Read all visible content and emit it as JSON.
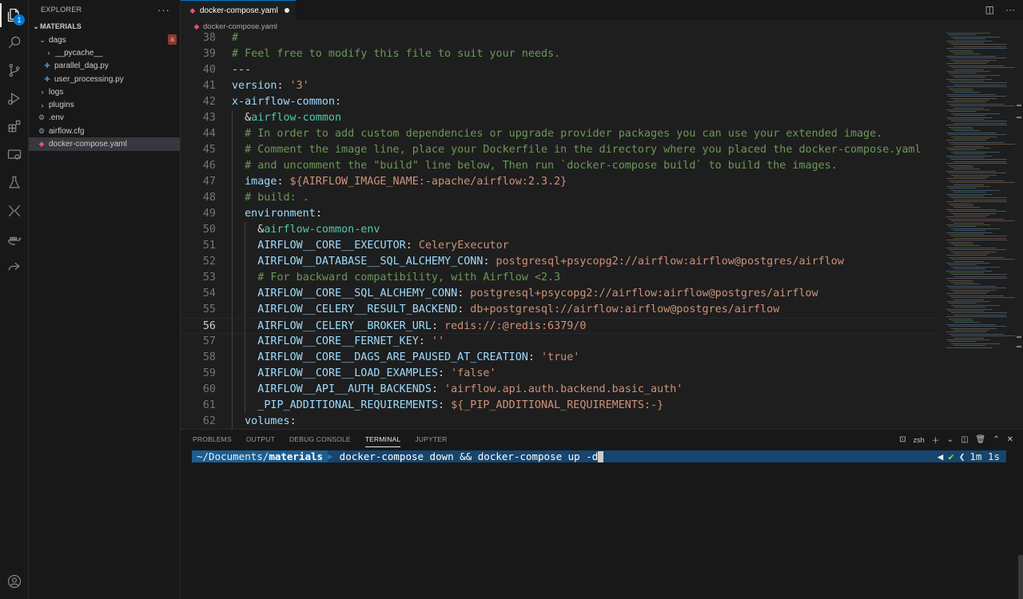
{
  "sidebar": {
    "title": "EXPLORER",
    "section": "MATERIALS",
    "items": [
      {
        "label": "dags",
        "git": "a"
      },
      {
        "label": "__pycache__"
      },
      {
        "label": "parallel_dag.py"
      },
      {
        "label": "user_processing.py"
      },
      {
        "label": "logs"
      },
      {
        "label": "plugins"
      },
      {
        "label": ".env"
      },
      {
        "label": "airflow.cfg"
      },
      {
        "label": "docker-compose.yaml"
      }
    ]
  },
  "activity": {
    "explorer_badge": "1"
  },
  "editor": {
    "tab_label": "docker-compose.yaml",
    "breadcrumb": "docker-compose.yaml",
    "lines": [
      {
        "n": "38",
        "t": "#"
      },
      {
        "n": "39",
        "t": "# Feel free to modify this file to suit your needs."
      },
      {
        "n": "40",
        "t": "---"
      },
      {
        "n": "41",
        "k": "version",
        "v": " '3'"
      },
      {
        "n": "42",
        "k": "x-airflow-common",
        "v": ""
      },
      {
        "n": "43",
        "a": "&airflow-common"
      },
      {
        "n": "44",
        "t": "# In order to add custom dependencies or upgrade provider packages you can use your extended image."
      },
      {
        "n": "45",
        "t": "# Comment the image line, place your Dockerfile in the directory where you placed the docker-compose.yaml"
      },
      {
        "n": "46",
        "t": "# and uncomment the \"build\" line below, Then run `docker-compose build` to build the images."
      },
      {
        "n": "47",
        "k": "image",
        "v": " ${AIRFLOW_IMAGE_NAME:-apache/airflow:2.3.2}"
      },
      {
        "n": "48",
        "t": "# build: ."
      },
      {
        "n": "49",
        "k": "environment",
        "v": ""
      },
      {
        "n": "50",
        "a": "&airflow-common-env"
      },
      {
        "n": "51",
        "k": "AIRFLOW__CORE__EXECUTOR",
        "v": " CeleryExecutor"
      },
      {
        "n": "52",
        "k": "AIRFLOW__DATABASE__SQL_ALCHEMY_CONN",
        "v": " postgresql+psycopg2://airflow:airflow@postgres/airflow"
      },
      {
        "n": "53",
        "t": "# For backward compatibility, with Airflow <2.3"
      },
      {
        "n": "54",
        "k": "AIRFLOW__CORE__SQL_ALCHEMY_CONN",
        "v": " postgresql+psycopg2://airflow:airflow@postgres/airflow"
      },
      {
        "n": "55",
        "k": "AIRFLOW__CELERY__RESULT_BACKEND",
        "v": " db+postgresql://airflow:airflow@postgres/airflow"
      },
      {
        "n": "56",
        "k": "AIRFLOW__CELERY__BROKER_URL",
        "v": " redis://:@redis:6379/0"
      },
      {
        "n": "57",
        "k": "AIRFLOW__CORE__FERNET_KEY",
        "v": " ''"
      },
      {
        "n": "58",
        "k": "AIRFLOW__CORE__DAGS_ARE_PAUSED_AT_CREATION",
        "v": " 'true'"
      },
      {
        "n": "59",
        "k": "AIRFLOW__CORE__LOAD_EXAMPLES",
        "v": " 'false'"
      },
      {
        "n": "60",
        "k": "AIRFLOW__API__AUTH_BACKENDS",
        "v": " 'airflow.api.auth.backend.basic_auth'"
      },
      {
        "n": "61",
        "k": "_PIP_ADDITIONAL_REQUIREMENTS",
        "v": " ${_PIP_ADDITIONAL_REQUIREMENTS:-}"
      },
      {
        "n": "62",
        "k": "volumes",
        "v": ""
      }
    ]
  },
  "panel": {
    "tabs": [
      "PROBLEMS",
      "OUTPUT",
      "DEBUG CONSOLE",
      "TERMINAL",
      "JUPYTER"
    ],
    "active_tab": "TERMINAL",
    "shell": "zsh",
    "terminal": {
      "path_prefix": "~/Documents/",
      "path_dir": "materials",
      "command": "docker-compose down && docker-compose up -d",
      "status": "✔",
      "duration": "1m 1s"
    }
  }
}
